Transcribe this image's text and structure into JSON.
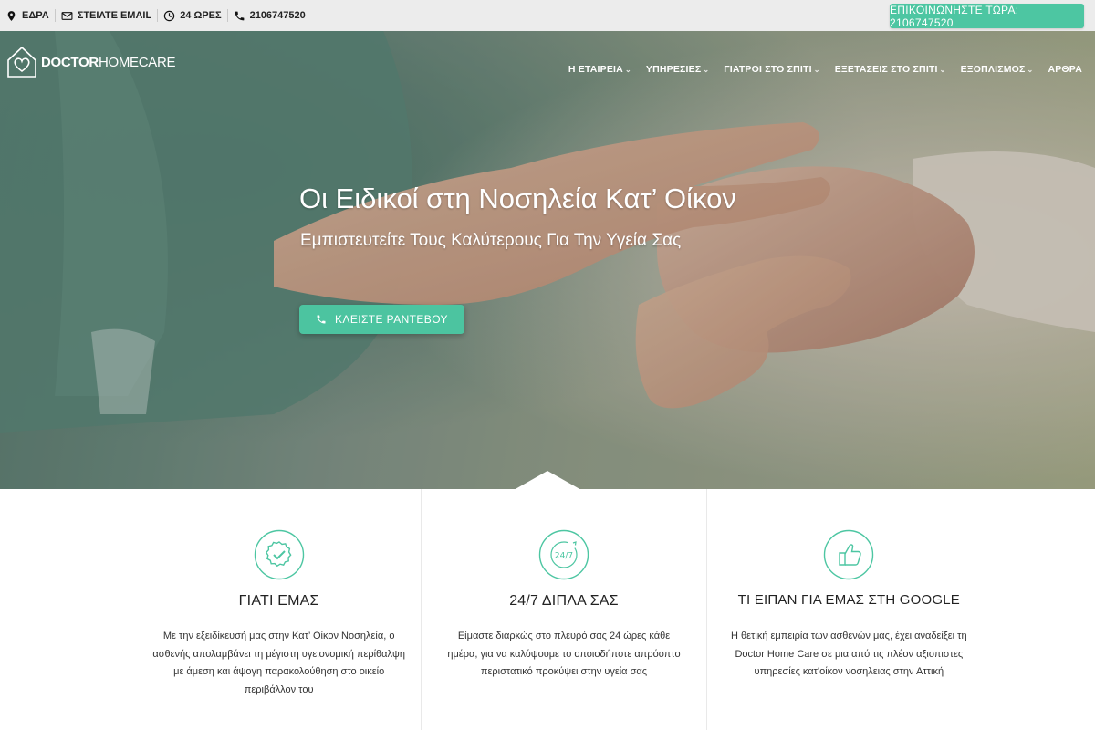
{
  "topbar": {
    "location_label": "ΕΔΡΑ",
    "email_label": "ΣΤΕΙΛΤΕ EMAIL",
    "hours_label": "24 ΩΡΕΣ",
    "phone_label": "2106747520",
    "cta_label": "ΕΠΙΚΟΙΝΩΝΗΣΤΕ ΤΩΡΑ: 2106747520"
  },
  "logo": {
    "part1": "DOCTOR",
    "part2": "HOME",
    "part3": "CARE"
  },
  "nav": {
    "items": [
      {
        "label": "Η ΕΤΑΙΡΕΙΑ",
        "has_dropdown": true
      },
      {
        "label": "ΥΠΗΡΕΣΙΕΣ",
        "has_dropdown": true
      },
      {
        "label": "ΓΙΑΤΡΟΙ ΣΤΟ ΣΠΙΤΙ",
        "has_dropdown": true
      },
      {
        "label": "ΕΞΕΤΑΣΕΙΣ ΣΤΟ ΣΠΙΤΙ",
        "has_dropdown": true
      },
      {
        "label": "ΕΞΟΠΛΙΣΜΟΣ",
        "has_dropdown": true
      },
      {
        "label": "ΑΡΘΡΑ",
        "has_dropdown": false
      }
    ]
  },
  "hero": {
    "title": "Οι Ειδικοί στη Νοσηλεία Κατ’ Οίκον",
    "subtitle": "Εμπιστευτείτε Τους Καλύτερους Για Την Υγεία Σας",
    "button_label": "ΚΛΕΙΣΤΕ ΡΑΝΤΕΒΟΥ"
  },
  "features": [
    {
      "title": "ΓΙΑΤΙ ΕΜΑΣ",
      "text": "Με την εξειδίκευσή μας στην Κατ’ Οίκον Νοσηλεία, ο ασθενής απολαμβάνει τη μέγιστη υγειονομική περίθαλψη με άμεση και άψογη παρακολούθηση στο οικείο περιβάλλον του",
      "icon": "verified-badge-icon"
    },
    {
      "title": "24/7 ΔΙΠΛΑ ΣΑΣ",
      "text": "Είμαστε διαρκώς στο πλευρό σας 24 ώρες κάθε ημέρα, για να καλύψουμε το οποιοδήποτε απρόοπτο περιστατικό προκύψει στην υγεία σας",
      "icon": "twenty-four-seven-icon"
    },
    {
      "title": "ΤΙ ΕΙΠΑΝ ΓΙΑ ΕΜΑΣ ΣΤΗ GOOGLE",
      "text": "Η θετική εμπειρία των ασθενών μας, έχει αναδείξει τη Doctor Home Care σε μια από τις πλέον αξιοπιστες υπηρεσίες κατ'οίκον νοσηλειας στην Αττική",
      "icon": "thumbs-up-icon"
    }
  ],
  "colors": {
    "accent": "#4dc6a2",
    "topbar_bg": "#ececec",
    "text_dark": "#222222"
  }
}
